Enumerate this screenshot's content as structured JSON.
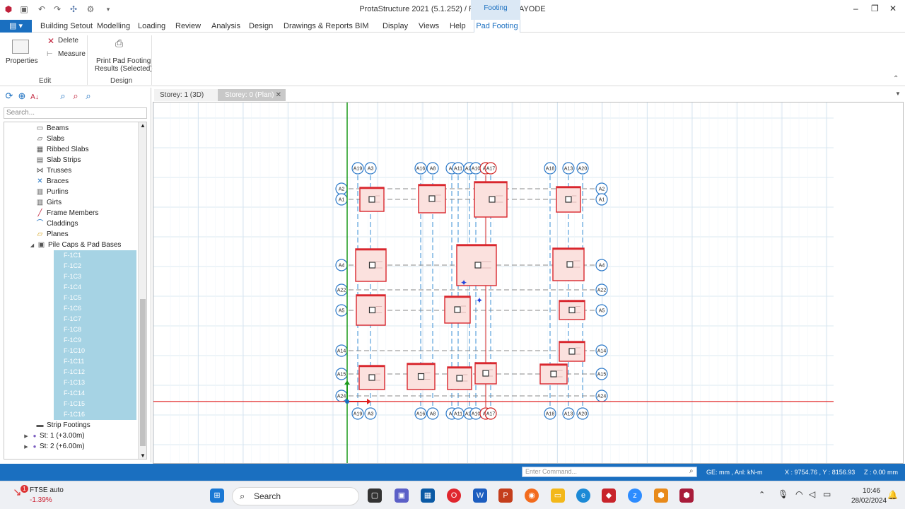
{
  "titlebar": {
    "title": "ProtaStructure 2021 (5.1.252) / Project: MR_KAYODE",
    "context_tab": "Footing"
  },
  "menu": {
    "file_icon": "file-menu-icon",
    "items": [
      "Building Setout",
      "Modelling",
      "Loading",
      "Review",
      "Analysis",
      "Design",
      "Drawings & Reports",
      "BIM",
      "Display",
      "Views",
      "Help"
    ],
    "active_context": "Pad Footing"
  },
  "ribbon": {
    "properties_label": "Properties",
    "delete_label": "Delete",
    "measure_label": "Measure",
    "print_label_line1": "Print Pad Footing",
    "print_label_line2": "Results (Selected)",
    "group_edit": "Edit",
    "group_design": "Design"
  },
  "left_panel": {
    "search_placeholder": "Search...",
    "tree_items": [
      "Beams",
      "Slabs",
      "Ribbed Slabs",
      "Slab Strips",
      "Trusses",
      "Braces",
      "Purlins",
      "Girts",
      "Frame Members",
      "Claddings",
      "Planes",
      "Pile Caps & Pad Bases"
    ],
    "footings": [
      "F-1C1",
      "F-1C2",
      "F-1C3",
      "F-1C4",
      "F-1C5",
      "F-1C6",
      "F-1C7",
      "F-1C8",
      "F-1C9",
      "F-1C10",
      "F-1C11",
      "F-1C12",
      "F-1C13",
      "F-1C14",
      "F-1C15",
      "F-1C16"
    ],
    "after_items": [
      "Strip Footings",
      "St: 1 (+3.00m)",
      "St: 2 (+6.00m)"
    ]
  },
  "view_tabs": {
    "tab_3d": "Storey: 1 (3D)",
    "tab_plan": "Storey: 0 (Plan)"
  },
  "grid_axes": {
    "top_labels": [
      "A19",
      "A3",
      "A16",
      "A8",
      "A7",
      "A11",
      "A23",
      "A10",
      "A6",
      "A17",
      "A18",
      "A13",
      "A20"
    ],
    "bottom_labels": [
      "A19",
      "A3",
      "A16",
      "A8",
      "A7",
      "A11",
      "A23",
      "A10",
      "A6",
      "A17",
      "A18",
      "A13",
      "A20"
    ],
    "left_labels": [
      "A2",
      "A1",
      "A4",
      "A22",
      "A5",
      "A14",
      "A15",
      "A24"
    ],
    "right_labels": [
      "A2",
      "A1",
      "A4",
      "A22",
      "A5",
      "A14",
      "A15",
      "A24"
    ]
  },
  "statusbar": {
    "command_placeholder": "Enter Command...",
    "units": "GE: mm , Anl: kN-m",
    "coords": "X : 9754.76 , Y : 8156.93",
    "z": "Z : 0.00 mm"
  },
  "taskbar": {
    "ticker_name": "FTSE auto",
    "ticker_change": "-1.39%",
    "ticker_badge": "1",
    "search_label": "Search",
    "time": "10:46",
    "date": "28/02/2024"
  }
}
